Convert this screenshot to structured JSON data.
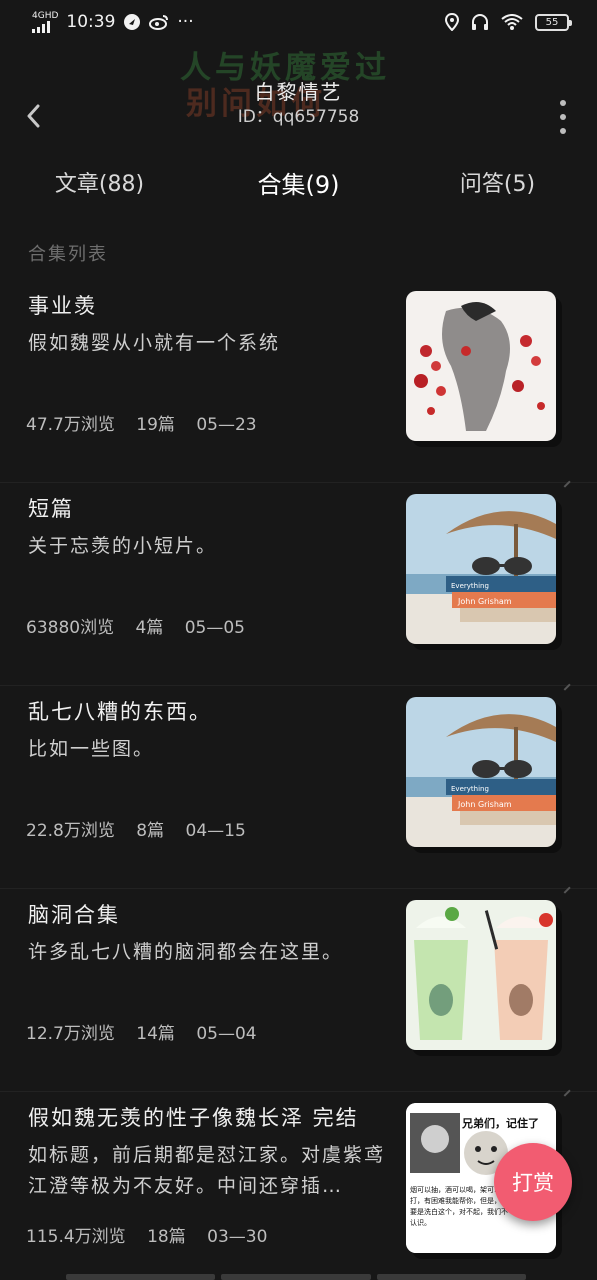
{
  "status_bar": {
    "network": "4GHD",
    "time": "10:39",
    "battery": "55"
  },
  "header": {
    "banner_line1": "人与妖魔爱过",
    "banner_line2": "别问如何",
    "user_name": "白黎情艺",
    "user_id": "ID：qq657758"
  },
  "tabs": [
    {
      "label": "文章(88)"
    },
    {
      "label": "合集(9)"
    },
    {
      "label": "问答(5)"
    }
  ],
  "section_title": "合集列表",
  "collections": [
    {
      "title": "事业羡",
      "desc": "假如魏婴从小就有一个系统",
      "views": "47.7万浏览",
      "count": "19篇",
      "date": "05—23"
    },
    {
      "title": "短篇",
      "desc": "关于忘羡的小短片。",
      "views": "63880浏览",
      "count": "4篇",
      "date": "05—05"
    },
    {
      "title": "乱七八糟的东西。",
      "desc": "比如一些图。",
      "views": "22.8万浏览",
      "count": "8篇",
      "date": "04—15"
    },
    {
      "title": "脑洞合集",
      "desc": "许多乱七八糟的脑洞都会在这里。",
      "views": "12.7万浏览",
      "count": "14篇",
      "date": "05—04"
    },
    {
      "title": "假如魏无羡的性子像魏长泽 完结",
      "desc": "如标题，前后期都是怼江家。对虞紫鸢江澄等极为不友好。中间还穿插…",
      "views": "115.4万浏览",
      "count": "18篇",
      "date": "03—30"
    }
  ],
  "thumb_texts": {
    "meme_caption": "兄弟们，记住了",
    "meme_body": "烟可以抽，酒可以喝，架可以打，有困难我能帮你，但是，谁要是洗白这个，对不起，我们不认识。",
    "book1": "Everything",
    "book2": "John Grisham"
  },
  "tip_button": "打赏",
  "colors": {
    "background": "#171717",
    "tip": "#f25c71"
  }
}
